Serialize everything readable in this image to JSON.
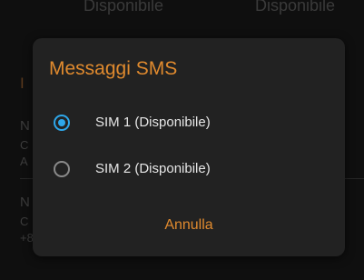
{
  "background": {
    "status_left": "Disponibile",
    "status_right": "Disponibile",
    "section_initial": "I",
    "rows": [
      {
        "line1": "N",
        "line2": "C",
        "line3": "A"
      },
      {
        "line1": "N",
        "line2": "C",
        "line3": "+8"
      }
    ]
  },
  "dialog": {
    "title": "Messaggi SMS",
    "options": [
      {
        "label": "SIM 1 (Disponibile)",
        "selected": true
      },
      {
        "label": "SIM 2 (Disponibile)",
        "selected": false
      }
    ],
    "cancel_label": "Annulla"
  },
  "colors": {
    "accent": "#e08a2e",
    "radio_selected": "#2ea7ea",
    "dialog_bg": "#222222",
    "screen_bg": "#0f0f0f"
  }
}
